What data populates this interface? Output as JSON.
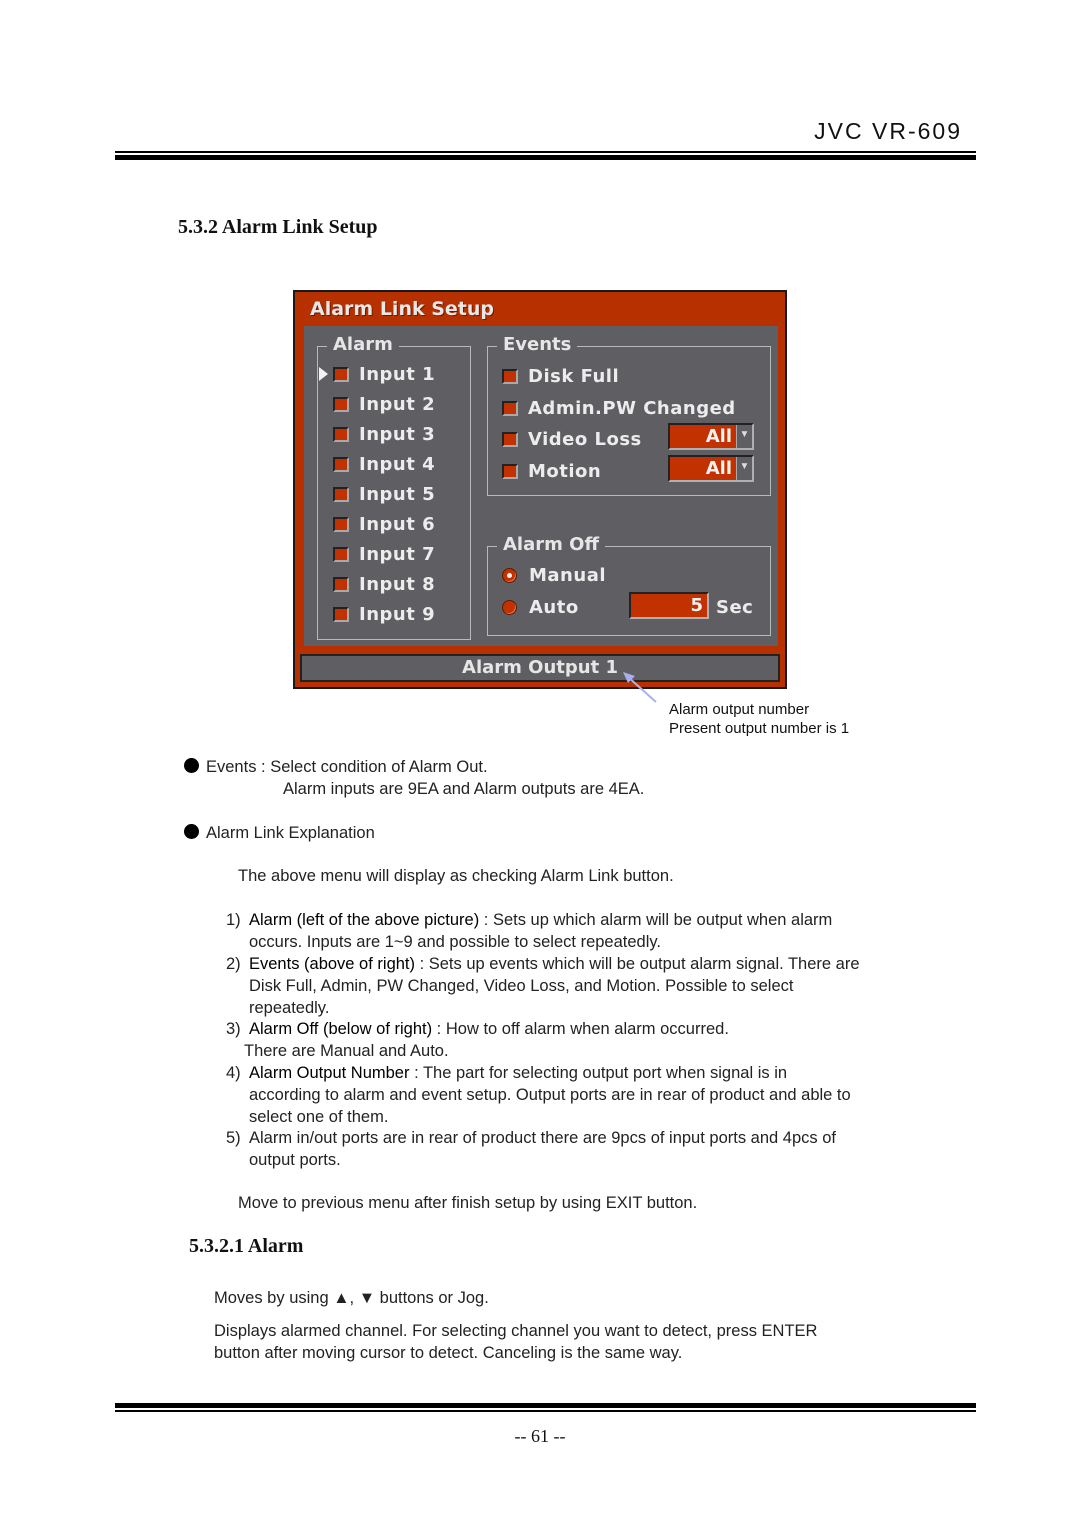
{
  "header": {
    "brand": "JVC VR-609"
  },
  "section": {
    "title": "5.3.2 Alarm Link Setup"
  },
  "osd": {
    "title": "Alarm Link Setup",
    "colors": {
      "frame": "#b73100",
      "panel": "#5f5f63",
      "field": "#c23200",
      "text": "#ececec"
    },
    "alarm_group": {
      "legend": "Alarm",
      "cursor_on": "Input 1",
      "inputs": [
        "Input 1",
        "Input 2",
        "Input 3",
        "Input 4",
        "Input 5",
        "Input 6",
        "Input 7",
        "Input 8",
        "Input 9"
      ]
    },
    "events_group": {
      "legend": "Events",
      "items": [
        {
          "label": "Disk Full"
        },
        {
          "label": "Admin.PW Changed"
        },
        {
          "label": "Video Loss",
          "dropdown": "All"
        },
        {
          "label": "Motion",
          "dropdown": "All"
        }
      ]
    },
    "alarm_off_group": {
      "legend": "Alarm Off",
      "manual_label": "Manual",
      "auto_label": "Auto",
      "selected": "Manual",
      "auto_value": "5",
      "auto_unit": "Sec"
    },
    "output_bar": "Alarm Output 1",
    "dropdown_icon": "chevron-down-icon"
  },
  "annotation": {
    "line1": "Alarm output number",
    "line2": "Present output number is 1"
  },
  "bullets": {
    "events": {
      "text": "Events : Select condition of Alarm Out.",
      "sub": "Alarm inputs are 9EA and Alarm outputs are 4EA."
    },
    "explanation": {
      "text": "Alarm Link Explanation"
    }
  },
  "intro": "The above menu will display as checking Alarm Link button.",
  "list": [
    {
      "num": "1)",
      "term": "Alarm (left of the above picture)",
      "line1": " : Sets up which alarm will be output when alarm",
      "rest": [
        "occurs. Inputs are 1~9 and possible to select repeatedly."
      ]
    },
    {
      "num": "2)",
      "term": "Events (above of right)",
      "line1": " : Sets up events which will be output alarm signal. There are",
      "rest": [
        "Disk Full, Admin, PW Changed, Video Loss, and Motion. Possible to select",
        "repeatedly."
      ]
    },
    {
      "num": "3)",
      "term": "Alarm Off (below of right)",
      "line1": " : How to off alarm when alarm occurred.",
      "rest": [
        "There are Manual and Auto."
      ]
    },
    {
      "num": "4)",
      "term": "Alarm Output Number",
      "line1": " : The part for selecting output port when signal is in",
      "rest": [
        "according to alarm and event setup. Output ports are in rear of product and able to",
        "select one of them."
      ]
    },
    {
      "num": "5)",
      "term": "",
      "line1": "Alarm in/out ports are in rear of product there are 9pcs of input ports and 4pcs of",
      "rest": [
        "output ports."
      ]
    }
  ],
  "outro": "Move to previous menu after finish setup by using EXIT button.",
  "subsection": {
    "title": "5.3.2.1 Alarm",
    "p1": "Moves by using ▲, ▼ buttons or Jog.",
    "p2_line1": "Displays alarmed channel. For selecting channel you want to detect, press ENTER",
    "p2_line2": "button after moving cursor to detect. Canceling is the same way."
  },
  "footer": {
    "page": "-- 61 --"
  }
}
